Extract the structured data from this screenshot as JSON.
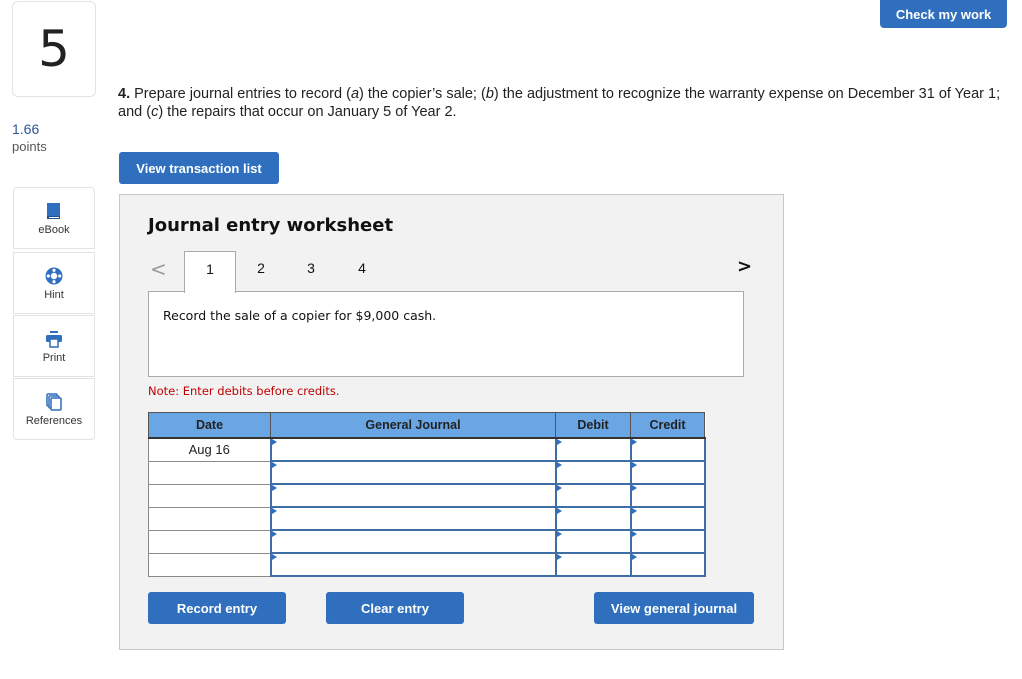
{
  "question_number": "5",
  "points": {
    "value": "1.66",
    "label": "points"
  },
  "header": {
    "check_button": "Check my work"
  },
  "sidebar": {
    "items": [
      {
        "label": "eBook",
        "icon": "book-icon"
      },
      {
        "label": "Hint",
        "icon": "lifebuoy-icon"
      },
      {
        "label": "Print",
        "icon": "printer-icon"
      },
      {
        "label": "References",
        "icon": "copy-icon"
      }
    ]
  },
  "question": {
    "number": "4.",
    "text_parts": [
      "Prepare journal entries to record (",
      "a",
      ") the copier’s sale; (",
      "b",
      ") the adjustment to recognize the warranty expense on December 31 of Year 1; and (",
      "c",
      ") the repairs that occur on January 5 of Year 2."
    ]
  },
  "view_transaction_button": "View transaction list",
  "worksheet": {
    "title": "Journal entry worksheet",
    "prev_arrow": "<",
    "next_arrow": ">",
    "tabs": [
      "1",
      "2",
      "3",
      "4"
    ],
    "active_tab": "1",
    "prompt": "Record the sale of a copier for $9,000 cash.",
    "note": "Note: Enter debits before credits.",
    "table": {
      "headers": [
        "Date",
        "General Journal",
        "Debit",
        "Credit"
      ],
      "rows": [
        {
          "date": "Aug 16",
          "account": "",
          "debit": "",
          "credit": ""
        },
        {
          "date": "",
          "account": "",
          "debit": "",
          "credit": ""
        },
        {
          "date": "",
          "account": "",
          "debit": "",
          "credit": ""
        },
        {
          "date": "",
          "account": "",
          "debit": "",
          "credit": ""
        },
        {
          "date": "",
          "account": "",
          "debit": "",
          "credit": ""
        },
        {
          "date": "",
          "account": "",
          "debit": "",
          "credit": ""
        }
      ]
    },
    "buttons": {
      "record": "Record entry",
      "clear": "Clear entry",
      "view_general_journal": "View general journal"
    }
  },
  "colors": {
    "primary_button": "#2f6fbd",
    "table_header": "#6aa6e4",
    "note_red": "#c00000",
    "points_blue": "#2a5599",
    "worksheet_bg": "#f2f2f2"
  }
}
